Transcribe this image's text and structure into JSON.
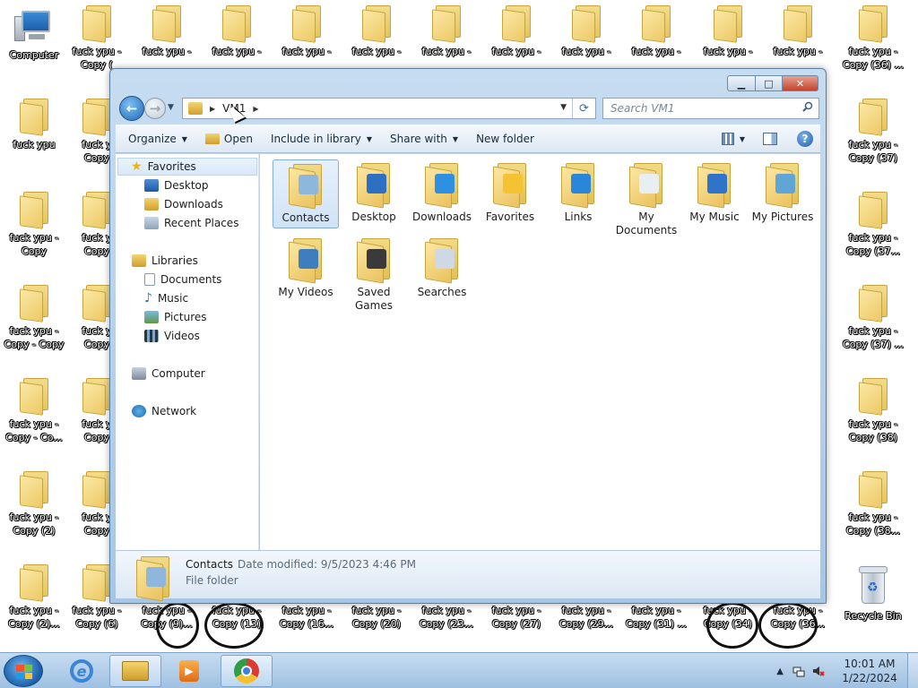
{
  "desktop": {
    "computer_label": "Computer",
    "recycle_label": "Recycle Bin",
    "icons": [
      {
        "label": "fuck ypu -\nCopy (",
        "col": 1,
        "row": 0
      },
      {
        "label": "fuck ypu -",
        "col": 2,
        "row": 0
      },
      {
        "label": "fuck ypu -",
        "col": 3,
        "row": 0
      },
      {
        "label": "fuck ypu -",
        "col": 4,
        "row": 0
      },
      {
        "label": "fuck ypu -",
        "col": 5,
        "row": 0
      },
      {
        "label": "fuck ypu -",
        "col": 6,
        "row": 0
      },
      {
        "label": "fuck ypu -",
        "col": 7,
        "row": 0
      },
      {
        "label": "fuck ypu -",
        "col": 8,
        "row": 0
      },
      {
        "label": "fuck ypu -",
        "col": 9,
        "row": 0
      },
      {
        "label": "fuck ypu -",
        "col": 10,
        "row": 0
      },
      {
        "label": "fuck ypu -",
        "col": 11,
        "row": 0
      },
      {
        "label": "fuck ypu -\nCopy (36) ...",
        "col": 12,
        "row": 0
      },
      {
        "label": "fuck ypu",
        "col": 0,
        "row": 1
      },
      {
        "label": "fuck y\nCopy",
        "col": 1,
        "row": 1
      },
      {
        "label": "fuck ypu -\nCopy (37)",
        "col": 12,
        "row": 1
      },
      {
        "label": "fuck ypu -\nCopy",
        "col": 0,
        "row": 2
      },
      {
        "label": "fuck y\nCopy",
        "col": 1,
        "row": 2
      },
      {
        "label": "fuck ypu -\nCopy (37...",
        "col": 12,
        "row": 2
      },
      {
        "label": "fuck ypu -\nCopy - Copy",
        "col": 0,
        "row": 3
      },
      {
        "label": "fuck y\nCopy",
        "col": 1,
        "row": 3
      },
      {
        "label": "fuck ypu -\nCopy (37) ...",
        "col": 12,
        "row": 3
      },
      {
        "label": "fuck ypu -\nCopy - Co...",
        "col": 0,
        "row": 4
      },
      {
        "label": "fuck y\nCopy",
        "col": 1,
        "row": 4
      },
      {
        "label": "fuck ypu -\nCopy (38)",
        "col": 12,
        "row": 4
      },
      {
        "label": "fuck ypu -\nCopy (2)",
        "col": 0,
        "row": 5
      },
      {
        "label": "fuck y\nCopy",
        "col": 1,
        "row": 5
      },
      {
        "label": "fuck ypu -\nCopy (38...",
        "col": 12,
        "row": 5
      },
      {
        "label": "fuck ypu -\nCopy (2)...",
        "col": 0,
        "row": 6
      },
      {
        "label": "fuck ypu -\nCopy (6)",
        "col": 1,
        "row": 6
      },
      {
        "label": "fuck ypu -\nCopy (9)...",
        "col": 2,
        "row": 6
      },
      {
        "label": "fuck ypu -\nCopy (13)",
        "col": 3,
        "row": 6
      },
      {
        "label": "fuck ypu -\nCopy (16...",
        "col": 4,
        "row": 6
      },
      {
        "label": "fuck ypu -\nCopy (20)",
        "col": 5,
        "row": 6
      },
      {
        "label": "fuck ypu -\nCopy (23...",
        "col": 6,
        "row": 6
      },
      {
        "label": "fuck ypu -\nCopy (27)",
        "col": 7,
        "row": 6
      },
      {
        "label": "fuck ypu -\nCopy (29...",
        "col": 8,
        "row": 6
      },
      {
        "label": "fuck ypu -\nCopy (31) ...",
        "col": 9,
        "row": 6
      },
      {
        "label": "fuck ypu -\nCopy (34)",
        "col": 10,
        "row": 6
      },
      {
        "label": "fuck ypu -\nCopy (36...",
        "col": 11,
        "row": 6
      }
    ]
  },
  "window": {
    "caption": {
      "minimize": "▁",
      "maximize": "□",
      "close": "✕"
    },
    "address": {
      "segment": "VM1"
    },
    "search": {
      "placeholder": "Search VM1"
    },
    "toolbar": {
      "organize": "Organize",
      "open": "Open",
      "include": "Include in library",
      "share": "Share with",
      "new_folder": "New folder"
    },
    "nav": {
      "favorites": "Favorites",
      "desktop": "Desktop",
      "downloads": "Downloads",
      "recent": "Recent Places",
      "libraries": "Libraries",
      "documents": "Documents",
      "music": "Music",
      "pictures": "Pictures",
      "videos": "Videos",
      "computer": "Computer",
      "network": "Network"
    },
    "items": [
      {
        "label": "Contacts",
        "overlay": "#8fb6dc",
        "selected": true
      },
      {
        "label": "Desktop",
        "overlay": "#2d6fc0"
      },
      {
        "label": "Downloads",
        "overlay": "#2f8fe0"
      },
      {
        "label": "Favorites",
        "overlay": "#f5c231"
      },
      {
        "label": "Links",
        "overlay": "#2a86d8"
      },
      {
        "label": "My Documents",
        "overlay": "#e9eef3"
      },
      {
        "label": "My Music",
        "overlay": "#2f74c9"
      },
      {
        "label": "My Pictures",
        "overlay": "#5fa6d6"
      },
      {
        "label": "My Videos",
        "overlay": "#3e7ebf"
      },
      {
        "label": "Saved Games",
        "overlay": "#3a3a3a"
      },
      {
        "label": "Searches",
        "overlay": "#cfd9e3"
      }
    ],
    "details": {
      "name": "Contacts",
      "modified": "Date modified:  9/5/2023 4:46 PM",
      "type": "File folder"
    }
  },
  "taskbar": {
    "time": "10:01 AM",
    "date": "1/22/2024"
  }
}
